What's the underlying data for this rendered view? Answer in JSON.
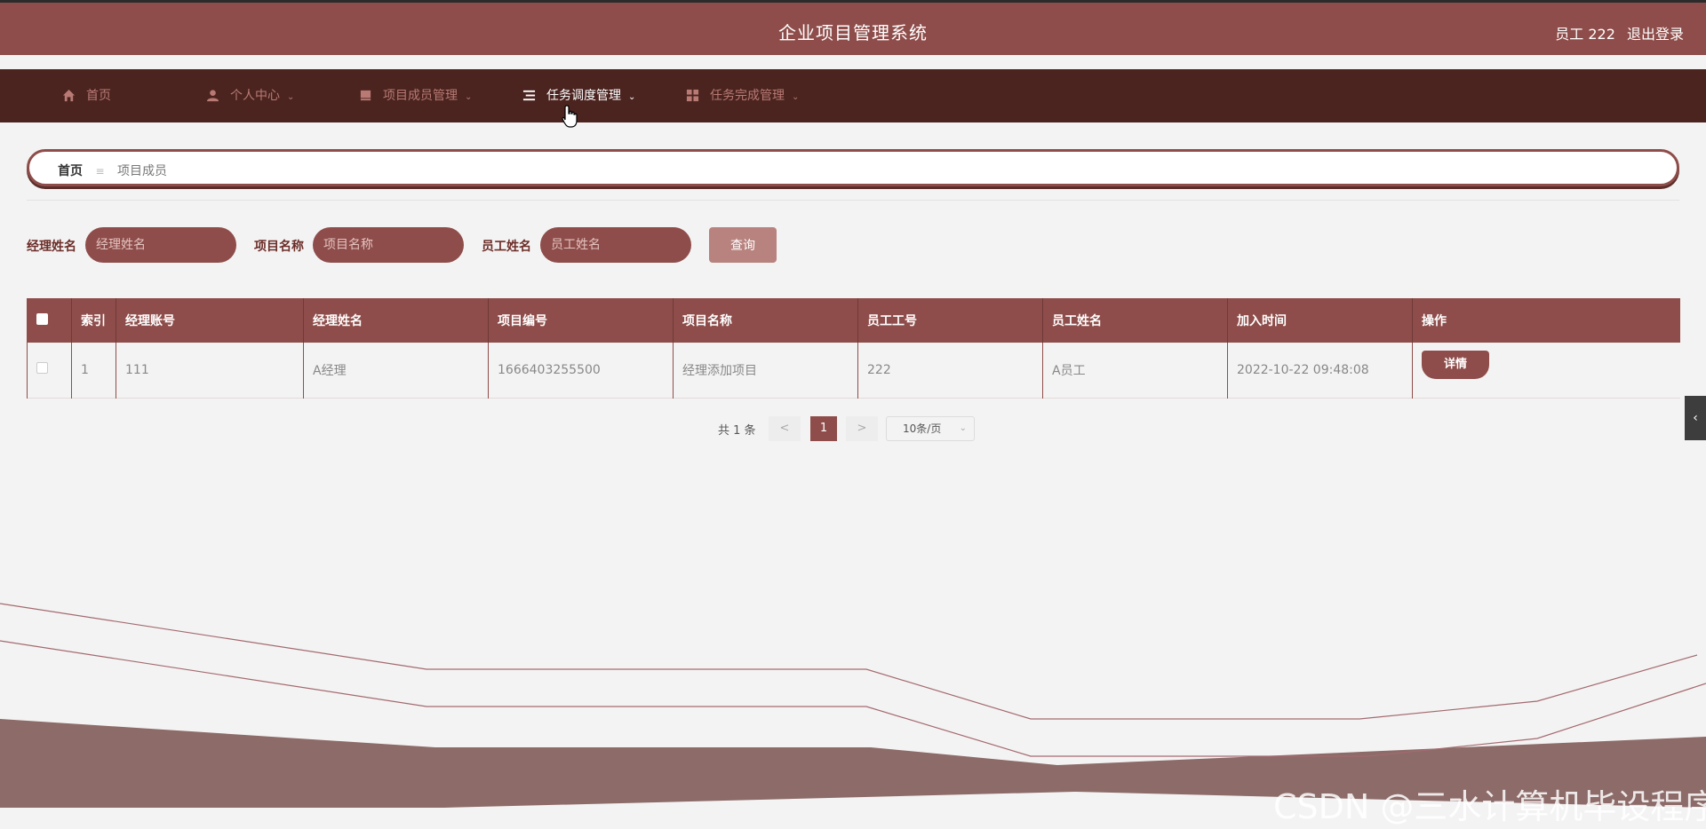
{
  "header": {
    "title": "企业项目管理系统",
    "user_label": "员工 222",
    "logout_label": "退出登录"
  },
  "nav": {
    "items": [
      {
        "label": "首页",
        "icon": "home-icon"
      },
      {
        "label": "个人中心",
        "icon": "user-icon"
      },
      {
        "label": "项目成员管理",
        "icon": "book-icon"
      },
      {
        "label": "任务调度管理",
        "icon": "list-icon"
      },
      {
        "label": "任务完成管理",
        "icon": "grid-icon"
      }
    ],
    "active_index": 3
  },
  "breadcrumb": {
    "home": "首页",
    "separator": "≡",
    "current": "项目成员"
  },
  "search": {
    "manager_name_label": "经理姓名",
    "manager_name_placeholder": "经理姓名",
    "project_name_label": "项目名称",
    "project_name_placeholder": "项目名称",
    "employee_name_label": "员工姓名",
    "employee_name_placeholder": "员工姓名",
    "query_button": "查询"
  },
  "table": {
    "headers": [
      "索引",
      "经理账号",
      "经理姓名",
      "项目编号",
      "项目名称",
      "员工工号",
      "员工姓名",
      "加入时间",
      "操作"
    ],
    "rows": [
      {
        "index": "1",
        "manager_account": "111",
        "manager_name": "A经理",
        "project_no": "1666403255500",
        "project_name": "经理添加项目",
        "employee_no": "222",
        "employee_name": "A员工",
        "join_time": "2022-10-22 09:48:08",
        "action": "详情"
      }
    ]
  },
  "pagination": {
    "total_text": "共 1 条",
    "prev": "<",
    "current_page": "1",
    "next": ">",
    "page_size": "10条/页"
  },
  "side_toggle": "‹",
  "watermark": "CSDN @三水计算机毕设程序",
  "colors": {
    "primary": "#8e4d4a",
    "nav_bg": "#4b2420",
    "background": "#f4f3f3"
  }
}
